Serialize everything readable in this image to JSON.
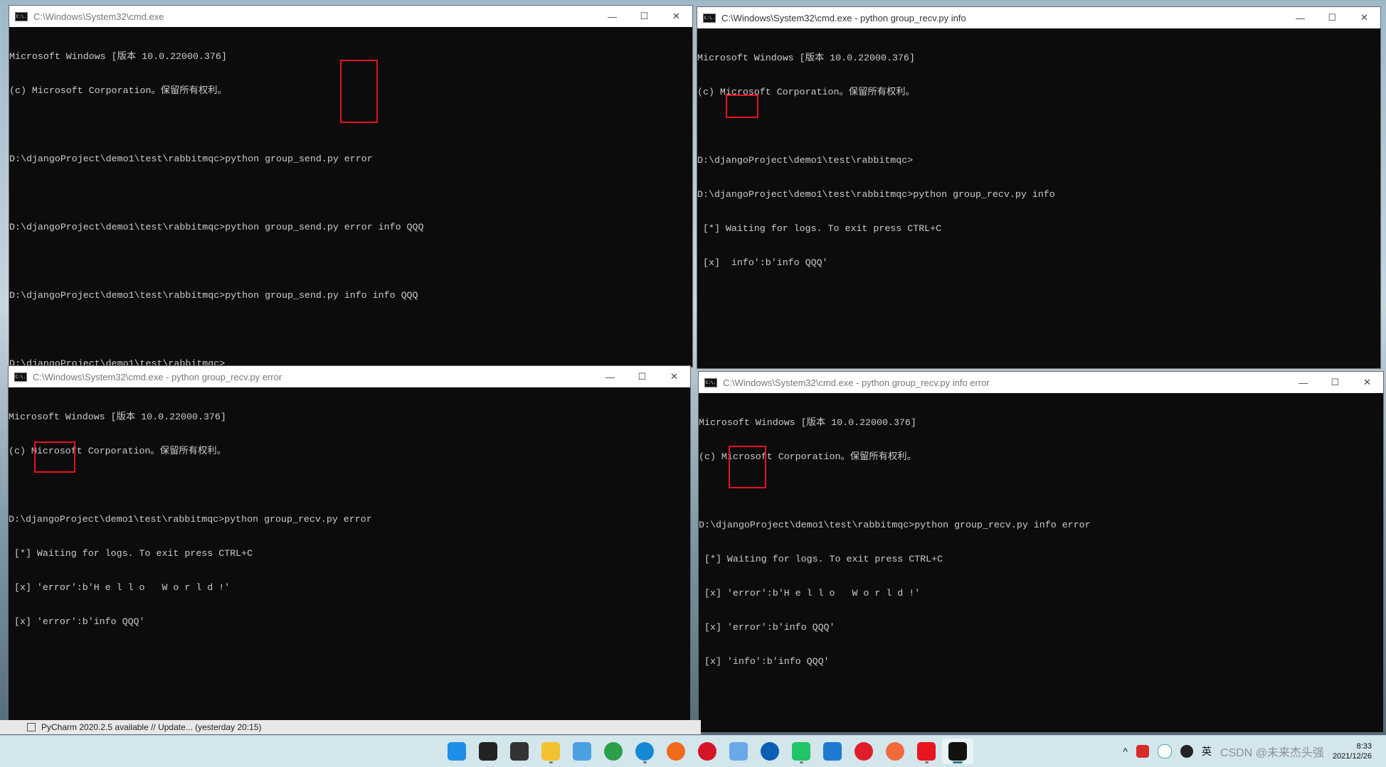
{
  "windows": [
    {
      "title": "C:\\Windows\\System32\\cmd.exe",
      "lines": [
        "Microsoft Windows [版本 10.0.22000.376]",
        "(c) Microsoft Corporation。保留所有权利。",
        "",
        "D:\\djangoProject\\demo1\\test\\rabbitmqc>python group_send.py error",
        "",
        "D:\\djangoProject\\demo1\\test\\rabbitmqc>python group_send.py error info QQQ",
        "",
        "D:\\djangoProject\\demo1\\test\\rabbitmqc>python group_send.py info info QQQ",
        "",
        "D:\\djangoProject\\demo1\\test\\rabbitmqc>"
      ]
    },
    {
      "title": "C:\\Windows\\System32\\cmd.exe - python  group_recv.py info",
      "lines": [
        "Microsoft Windows [版本 10.0.22000.376]",
        "(c) Microsoft Corporation。保留所有权利。",
        "",
        "D:\\djangoProject\\demo1\\test\\rabbitmqc>",
        "D:\\djangoProject\\demo1\\test\\rabbitmqc>python group_recv.py info",
        " [*] Waiting for logs. To exit press CTRL+C",
        " [x]  info':b'info QQQ'"
      ]
    },
    {
      "title": "C:\\Windows\\System32\\cmd.exe - python  group_recv.py error",
      "lines": [
        "Microsoft Windows [版本 10.0.22000.376]",
        "(c) Microsoft Corporation。保留所有权利。",
        "",
        "D:\\djangoProject\\demo1\\test\\rabbitmqc>python group_recv.py error",
        " [*] Waiting for logs. To exit press CTRL+C",
        " [x] 'error':b'H e l l o   W o r l d !'",
        " [x] 'error':b'info QQQ'"
      ]
    },
    {
      "title": "C:\\Windows\\System32\\cmd.exe - python  group_recv.py info error",
      "lines": [
        "Microsoft Windows [版本 10.0.22000.376]",
        "(c) Microsoft Corporation。保留所有权利。",
        "",
        "D:\\djangoProject\\demo1\\test\\rabbitmqc>python group_recv.py info error",
        " [*] Waiting for logs. To exit press CTRL+C",
        " [x] 'error':b'H e l l o   W o r l d !'",
        " [x] 'error':b'info QQQ'",
        " [x] 'info':b'info QQQ'"
      ]
    }
  ],
  "window_controls": {
    "minimize": "—",
    "maximize": "☐",
    "close": "✕"
  },
  "app_icon_text": "C:\\.",
  "statusbar": {
    "text": "PyCharm 2020.2.5 available // Update... (yesterday 20:15)"
  },
  "taskbar": {
    "icons": [
      {
        "name": "windows-start",
        "color": "#1f8ee6"
      },
      {
        "name": "search",
        "color": "#222222"
      },
      {
        "name": "task-view",
        "color": "#333333"
      },
      {
        "name": "file-explorer",
        "color": "#f2c230",
        "running": true
      },
      {
        "name": "paint",
        "color": "#4aa0e0"
      },
      {
        "name": "chrome",
        "color": "#2aa04a"
      },
      {
        "name": "edge",
        "color": "#1588d6",
        "running": true
      },
      {
        "name": "firefox",
        "color": "#f06a1e"
      },
      {
        "name": "opera",
        "color": "#d41525"
      },
      {
        "name": "app-rings",
        "color": "#6aa8e8"
      },
      {
        "name": "video-player",
        "color": "#0a5fb5"
      },
      {
        "name": "pycharm",
        "color": "#21c466",
        "running": true
      },
      {
        "name": "vscode",
        "color": "#1f7bd1"
      },
      {
        "name": "netease-music",
        "color": "#e01e2a"
      },
      {
        "name": "pen-app",
        "color": "#f06a3a"
      },
      {
        "name": "youdao",
        "color": "#e8161e",
        "running": true
      },
      {
        "name": "terminal",
        "color": "#111111",
        "active": true
      }
    ],
    "tray": {
      "chevron": "^",
      "ime": "英",
      "time": "8:33",
      "date": "2021/12/26",
      "watermark": "CSDN @未来杰头强"
    }
  },
  "colors": {
    "highlight_box": "#e81123",
    "console_bg": "#0c0c0c",
    "console_text": "#cccccc"
  }
}
